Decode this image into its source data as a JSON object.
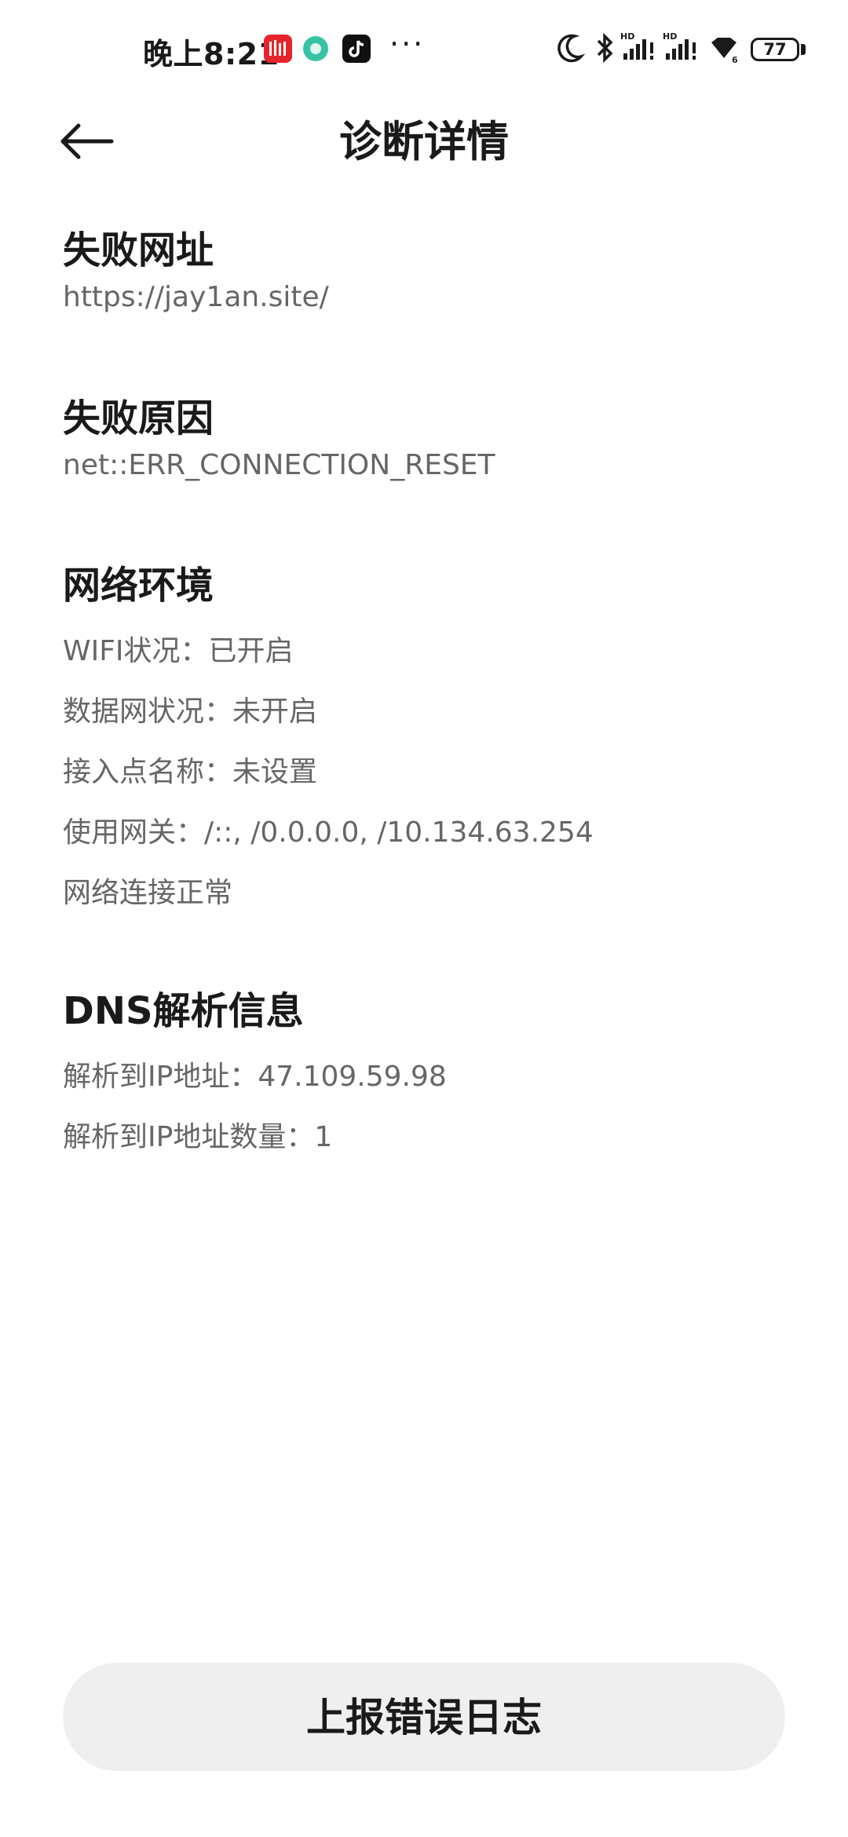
{
  "status_bar": {
    "time": "晚上8:21",
    "more": "···",
    "battery": "77"
  },
  "header": {
    "title": "诊断详情"
  },
  "sections": {
    "failed_url": {
      "heading": "失败网址",
      "value": "https://jay1an.site/"
    },
    "failure_reason": {
      "heading": "失败原因",
      "value": "net::ERR_CONNECTION_RESET"
    },
    "network": {
      "heading": "网络环境",
      "lines": [
        "WIFI状况：已开启",
        "数据网状况：未开启",
        "接入点名称：未设置",
        "使用网关：/::, /0.0.0.0, /10.134.63.254",
        "网络连接正常"
      ]
    },
    "dns": {
      "heading": "DNS解析信息",
      "lines": [
        "解析到IP地址：47.109.59.98",
        "解析到IP地址数量：1"
      ]
    }
  },
  "footer": {
    "report_button": "上报错误日志"
  }
}
